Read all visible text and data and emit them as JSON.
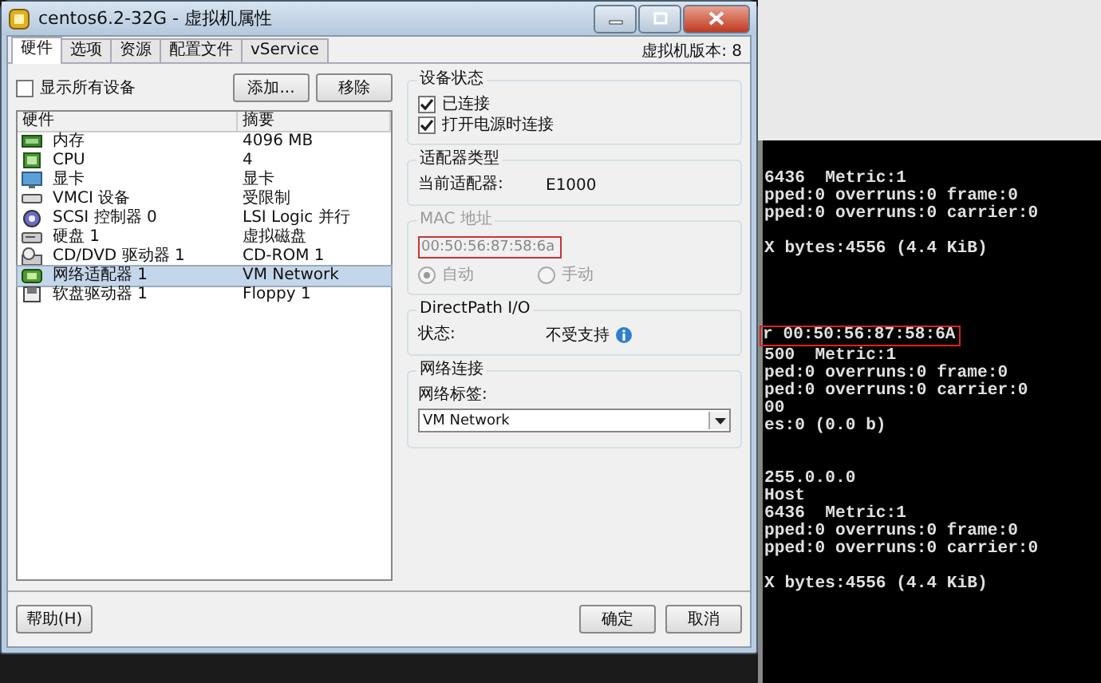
{
  "window": {
    "title": "centos6.2-32G - 虚拟机属性"
  },
  "tabs": [
    {
      "label": "硬件",
      "selected": true
    },
    {
      "label": "选项",
      "selected": false
    },
    {
      "label": "资源",
      "selected": false
    },
    {
      "label": "配置文件",
      "selected": false
    },
    {
      "label": "vService",
      "selected": false
    }
  ],
  "vm_version": "虚拟机版本: 8",
  "show_all_devices": {
    "label": "显示所有设备",
    "checked": false
  },
  "hardware_buttons": [
    "添加...",
    "移除"
  ],
  "hardware_table": {
    "columns": [
      "硬件",
      "摘要"
    ],
    "rows": [
      {
        "kind": "memory",
        "device": "内存",
        "summary": "4096 MB",
        "selected": false
      },
      {
        "kind": "cpu",
        "device": "CPU",
        "summary": "4",
        "selected": false
      },
      {
        "kind": "display",
        "device": "显卡",
        "summary": "显卡",
        "selected": false
      },
      {
        "kind": "vmci",
        "device": "VMCI 设备",
        "summary": "受限制",
        "selected": false
      },
      {
        "kind": "scsi",
        "device": "SCSI 控制器 0",
        "summary": "LSI Logic 并行",
        "selected": false
      },
      {
        "kind": "disk",
        "device": "硬盘 1",
        "summary": "虚拟磁盘",
        "selected": false
      },
      {
        "kind": "cdrom",
        "device": "CD/DVD 驱动器 1",
        "summary": "CD-ROM 1",
        "selected": false
      },
      {
        "kind": "network",
        "device": "网络适配器 1",
        "summary": "VM Network",
        "selected": true
      },
      {
        "kind": "floppy",
        "device": "软盘驱动器 1",
        "summary": "Floppy 1",
        "selected": false
      }
    ]
  },
  "device_status": {
    "title": "设备状态",
    "options": [
      {
        "label": "已连接",
        "checked": true
      },
      {
        "label": "打开电源时连接",
        "checked": true
      }
    ]
  },
  "adapter_type": {
    "title": "适配器类型",
    "label": "当前适配器:",
    "value": "E1000"
  },
  "mac_address": {
    "title": "MAC 地址",
    "disabled": true,
    "value": "00:50:56:87:58:6a",
    "highlighted": true,
    "modes": [
      {
        "label": "自动",
        "selected": true
      },
      {
        "label": "手动",
        "selected": false
      }
    ]
  },
  "directpath": {
    "title": "DirectPath I/O",
    "label": "状态:",
    "value": "不受支持"
  },
  "network_connection": {
    "title": "网络连接",
    "label": "网络标签:",
    "value": "VM Network"
  },
  "help_button": "帮助(H)",
  "dialog_buttons": [
    "确定",
    "取消"
  ],
  "terminal": {
    "blocks": [
      [
        {
          "text": "6436  Metric:1",
          "highlighted": false
        },
        {
          "text": "pped:0 overruns:0 frame:0",
          "highlighted": false
        },
        {
          "text": "pped:0 overruns:0 carrier:0",
          "highlighted": false
        }
      ],
      [
        {
          "text": "X bytes:4556 (4.4 KiB)",
          "highlighted": false
        }
      ],
      [
        {
          "text": "r 00:50:56:87:58:6A",
          "highlighted": true
        },
        {
          "text": "500  Metric:1",
          "highlighted": false
        },
        {
          "text": "ped:0 overruns:0 frame:0",
          "highlighted": false
        },
        {
          "text": "ped:0 overruns:0 carrier:0",
          "highlighted": false
        },
        {
          "text": "00",
          "highlighted": false
        },
        {
          "text": "es:0 (0.0 b)",
          "highlighted": false
        }
      ],
      [
        {
          "text": "255.0.0.0",
          "highlighted": false
        },
        {
          "text": "Host",
          "highlighted": false
        },
        {
          "text": "6436  Metric:1",
          "highlighted": false
        },
        {
          "text": "pped:0 overruns:0 frame:0",
          "highlighted": false
        },
        {
          "text": "pped:0 overruns:0 carrier:0",
          "highlighted": false
        }
      ],
      [
        {
          "text": "X bytes:4556 (4.4 KiB)",
          "highlighted": false
        }
      ]
    ]
  }
}
